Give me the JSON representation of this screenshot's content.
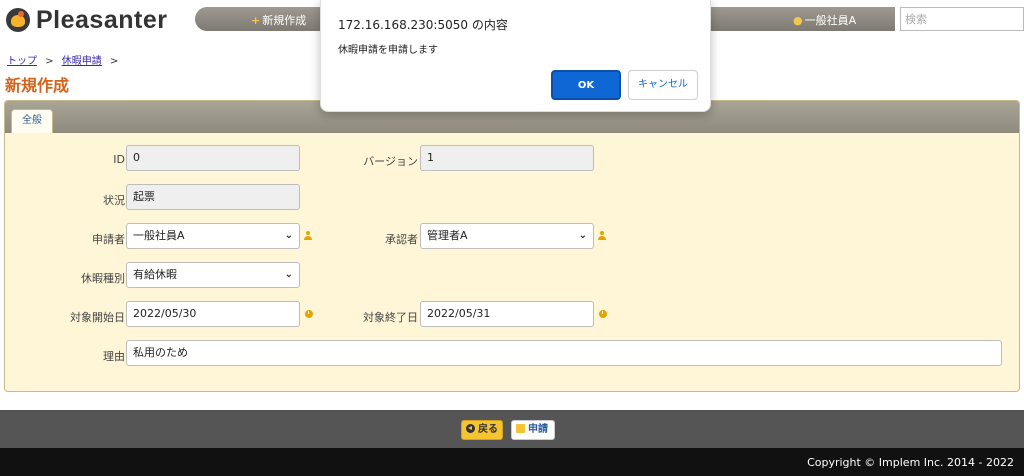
{
  "app": {
    "logo_text": "Pleasanter"
  },
  "header": {
    "new_label": "新規作成",
    "user_label": "一般社員A",
    "search_placeholder": "検索"
  },
  "breadcrumb": {
    "top": "トップ",
    "sep": ">",
    "section": "休暇申請"
  },
  "page": {
    "title": "新規作成"
  },
  "tabs": [
    {
      "label": "全般"
    }
  ],
  "form": {
    "id": {
      "label": "ID",
      "value": "0"
    },
    "version": {
      "label": "バージョン",
      "value": "1"
    },
    "status": {
      "label": "状況",
      "value": "起票"
    },
    "applicant": {
      "label": "申請者",
      "value": "一般社員A"
    },
    "approver": {
      "label": "承認者",
      "value": "管理者A"
    },
    "leave_type": {
      "label": "休暇種別",
      "value": "有給休暇"
    },
    "start_date": {
      "label": "対象開始日",
      "value": "2022/05/30"
    },
    "end_date": {
      "label": "対象終了日",
      "value": "2022/05/31"
    },
    "reason": {
      "label": "理由",
      "value": "私用のため"
    }
  },
  "actions": {
    "back_label": "戻る",
    "apply_label": "申請"
  },
  "footer": {
    "copyright": "Copyright © Implem Inc. 2014 - 2022"
  },
  "dialog": {
    "title": "172.16.168.230:5050 の内容",
    "message": "休暇申請を申請します",
    "ok_label": "OK",
    "cancel_label": "キャンセル"
  },
  "colors": {
    "accent": "#d4631c",
    "dialog_primary": "#0f67d6",
    "button_yellow": "#f5c431"
  },
  "icons": {
    "select": "chevron-down-icon",
    "user": "person-icon",
    "date": "clock-icon"
  }
}
